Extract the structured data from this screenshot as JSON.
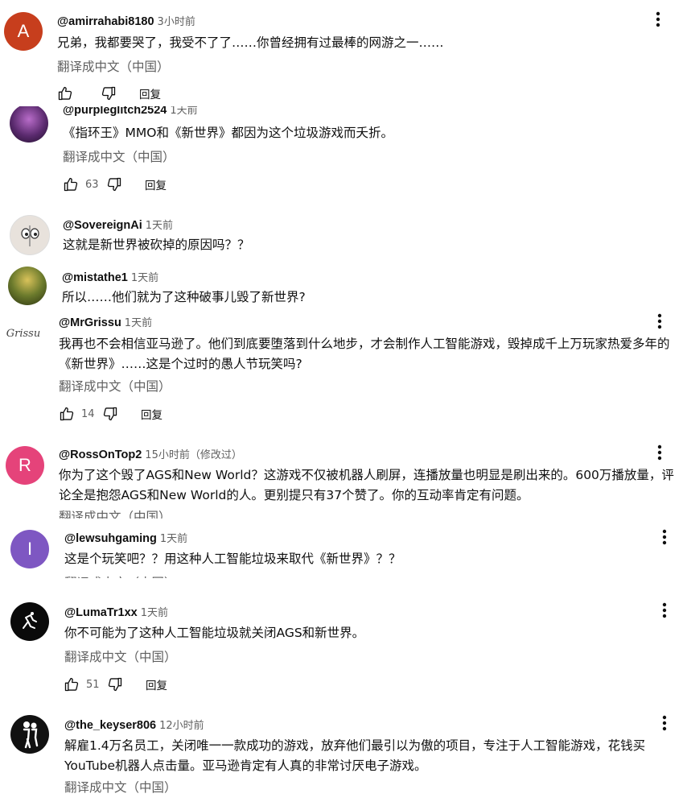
{
  "ui": {
    "translate_label": "翻译成中文（中国）",
    "reply_label": "回复"
  },
  "comments": [
    {
      "handle": "@amirrahabi8180",
      "time": "3小时前",
      "avatar_letter": "A",
      "avatar_color": "#c73e1d",
      "text": "兄弟，我都要哭了，我受不了了……你曾经拥有过最棒的网游之一……",
      "likes": ""
    },
    {
      "handle": "@purpleglitch2524",
      "time": "1天前",
      "avatar_letter": "",
      "avatar_color": "#3a1d47",
      "text": "《指环王》MMO和《新世界》都因为这个垃圾游戏而夭折。",
      "likes": "63"
    },
    {
      "handle": "@SovereignAi",
      "time": "1天前",
      "avatar_letter": "",
      "avatar_color": "#e8e2dc",
      "text": "这就是新世界被砍掉的原因吗？？",
      "likes": ""
    },
    {
      "handle": "@mistathe1",
      "time": "1天前",
      "avatar_letter": "",
      "avatar_color": "#4a5a2a",
      "text": "所以……他们就为了这种破事儿毁了新世界?",
      "likes": ""
    },
    {
      "handle": "@MrGrissu",
      "time": "1天前",
      "avatar_letter": "Grissu",
      "avatar_color": "#ffffff",
      "text": "我再也不会相信亚马逊了。他们到底要堕落到什么地步，才会制作人工智能游戏，毁掉成千上万玩家热爱多年的《新世界》……这是个过时的愚人节玩笑吗?",
      "likes": "14"
    },
    {
      "handle": "@RossOnTop2",
      "time": "15小时前（修改过）",
      "avatar_letter": "R",
      "avatar_color": "#e5437a",
      "text": "你为了这个毁了AGS和New World？这游戏不仅被机器人刷屏，连播放量也明显是刷出来的。600万播放量，评论全是抱怨AGS和New World的人。更别提只有37个赞了。你的互动率肯定有问题。",
      "likes": ""
    },
    {
      "handle": "@lewsuhgaming",
      "time": "1天前",
      "avatar_letter": "I",
      "avatar_color": "#7e57c2",
      "text": "这是个玩笑吧？？用这种人工智能垃圾来取代《新世界》？？",
      "likes": ""
    },
    {
      "handle": "@LumaTr1xx",
      "time": "1天前",
      "avatar_letter": "",
      "avatar_color": "#0a0a0a",
      "text": "你不可能为了这种人工智能垃圾就关闭AGS和新世界。",
      "likes": "51"
    },
    {
      "handle": "@the_keyser806",
      "time": "12小时前",
      "avatar_letter": "",
      "avatar_color": "#111111",
      "text": "解雇1.4万名员工，关闭唯一一款成功的游戏，放弃他们最引以为傲的项目，专注于人工智能游戏，花钱买YouTube机器人点击量。亚马逊肯定有人真的非常讨厌电子游戏。",
      "likes": ""
    }
  ]
}
